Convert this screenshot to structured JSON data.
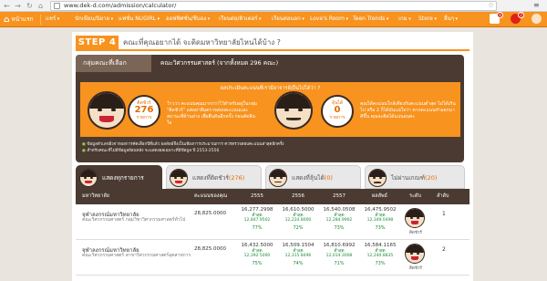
{
  "browser": {
    "url": "www.dek-d.com/admission/calculator/"
  },
  "topnav": {
    "home_label": "หน้าแรก",
    "items": [
      {
        "label": "แชร์"
      },
      {
        "label": "นักเขียน/นิยาย"
      },
      {
        "label": "แฟชั่น NUGIRL"
      },
      {
        "label": "ออฟฟิศชั่น/ชีบอง"
      },
      {
        "label": "เรียนต่อ/ติวเตอร์"
      },
      {
        "label": "เรียนต่อนอก"
      },
      {
        "label": "Love's Room"
      },
      {
        "label": "Teen Trends"
      },
      {
        "label": "เกม"
      },
      {
        "label": "Store"
      },
      {
        "label": "อื่นๆ"
      }
    ],
    "notif_count_1": "4",
    "notif_count_2": "7"
  },
  "step": {
    "label": "STEP 4",
    "question": "คณะที่คุณอยากได้ จะติดมหาวิทยาลัยไหนได้บ้าง ?"
  },
  "summary": {
    "faculty_label": "กลุ่มคณะที่เลือก",
    "major_label": "คณะวิศวกรรมศาสตร์ (จากทั้งหมด 296 คณะ)",
    "banner_header": "ผลประเมินคะแนนที่เรามีอาจารย์เป็นไปได้ว่า ?",
    "pass": {
      "title": "ติดชัวร์",
      "count": "276",
      "unit": "รายการ",
      "desc": "ว้าววว คะแนนคุณมากกว่าไว้สำหรับอยู่ในกลุ่ม \"ติดชัวร์\" แต่อย่าลืมตรวจสอบคะแนนและสถานะที่ด้านล่าง เพื่อยืนยันอีกครั้ง ก่อนตัดสินใจ"
    },
    "maybe": {
      "title": "ลุ้นได้",
      "count": "0",
      "unit": "รายการ",
      "desc": "คุณได้คะแนนใกล้เคียงกับคะแนนต่ำสุด ไม่ได้เกินไป หรือ 2 ก็ได้มันแน่ใจว่า หากคะแนนทำออกมาดีขึ้น คุณจะติดได้แน่นอนค่ะ"
    },
    "notes": [
      "ข้อมูลตัวเลขอิงจากผลการคัดเลือกปีที่แล้ว ผลลัพธ์จึงเป็นเพียงการประมาณการ ควรตรวจสอบคะแนนล่าสุดอีกครั้ง",
      "สำหรับคณะที่ไม่มีข้อมูลย้อนหลัง จะแสดงผลเฉพาะที่มีข้อมูล ปี 2553-2556"
    ]
  },
  "tabs": [
    {
      "label": "แสดงทุกรายการ",
      "count": ""
    },
    {
      "label": "แสดงที่ติดชัวร์",
      "count": "(276)"
    },
    {
      "label": "แสดงที่ลุ้นได้",
      "count": "(0)"
    },
    {
      "label": "ไม่ผ่านเกณฑ์",
      "count": "(20)"
    }
  ],
  "table": {
    "headers": {
      "university": "มหาวิทยาลัย",
      "seats": "คะแนนของคุณ",
      "y2555": "2555",
      "y2556": "2556",
      "y2557": "2557",
      "result": "ผลลัพธ์",
      "chance": "ระดับ",
      "rank": "ลำดับ"
    },
    "rows": [
      {
        "university": "จุฬาลงกรณ์มหาวิทยาลัย",
        "major": "คณะวิศวกรรมศาสตร์ กลุ่มวิชาวิศวกรรมศาสตร์ทั่วไป",
        "score": "28,825.0000",
        "y2555": {
          "pool": "16,277.2998",
          "p2": "ต่ำสุด",
          "p3": "12,847.9502",
          "pct": "77%"
        },
        "y2556": {
          "pool": "16,610.5000",
          "p2": "ต่ำสุด",
          "p3": "12,224.8000",
          "pct": "72%"
        },
        "y2557": {
          "pool": "16,540.0508",
          "p2": "ต่ำสุด",
          "p3": "12,284.9902",
          "pct": "73%"
        },
        "y2558": {
          "pool": "16,475.9502",
          "p2": "ต่ำสุด",
          "p3": "12,349.0498",
          "pct": "73%"
        },
        "tag": "ติดชัวร์",
        "rank": "1"
      },
      {
        "university": "จุฬาลงกรณ์มหาวิทยาลัย",
        "major": "คณะวิศวกรรมศาสตร์ สาขาวิศวกรรมศาสตร์อุตสาหการ",
        "score": "28,825.0000",
        "y2555": {
          "pool": "16,432.5000",
          "p2": "ต่ำสุด",
          "p3": "12,392.5000",
          "pct": "75%"
        },
        "y2556": {
          "pool": "16,509.1504",
          "p2": "ต่ำสุด",
          "p3": "12,315.8496",
          "pct": "74%"
        },
        "y2557": {
          "pool": "16,810.6992",
          "p2": "ต่ำสุด",
          "p3": "12,014.3008",
          "pct": "71%"
        },
        "y2558": {
          "pool": "16,584.1165",
          "p2": "ต่ำสุด",
          "p3": "12,240.8835",
          "pct": "73%"
        },
        "tag": "ติดชัวร์",
        "rank": "2"
      }
    ]
  },
  "colors": {
    "brand_orange": "#f7931e",
    "dark_brown": "#4a3a31",
    "pass_green": "#1a8a3a"
  }
}
